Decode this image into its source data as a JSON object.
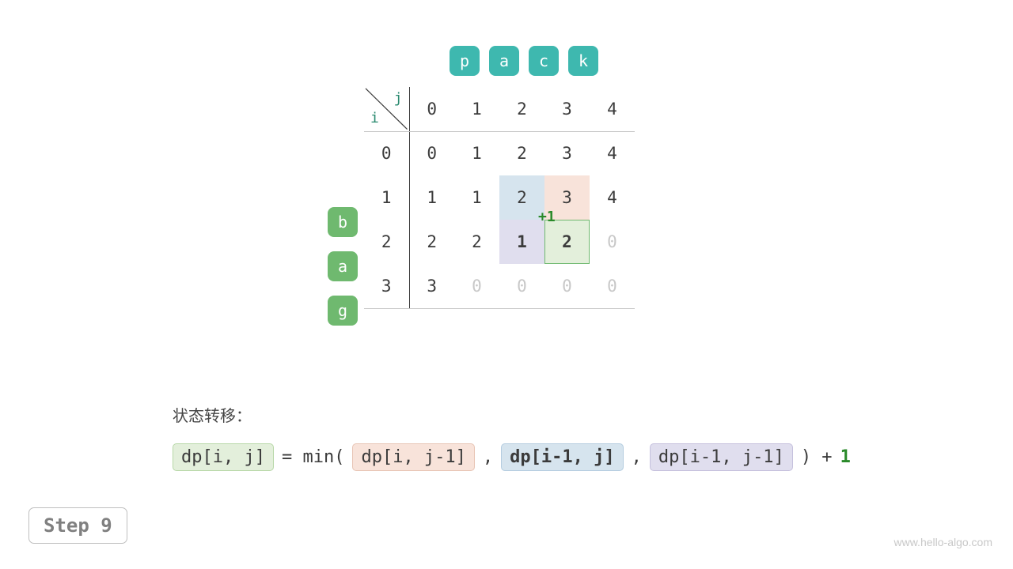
{
  "target": {
    "chars": [
      "p",
      "a",
      "c",
      "k"
    ]
  },
  "source": {
    "chars": [
      "b",
      "a",
      "g"
    ]
  },
  "axis": {
    "i": "i",
    "j": "j"
  },
  "table": {
    "col_headers": [
      "0",
      "1",
      "2",
      "3",
      "4"
    ],
    "row_headers": [
      "0",
      "1",
      "2",
      "3"
    ],
    "rows": [
      [
        {
          "v": "0"
        },
        {
          "v": "1"
        },
        {
          "v": "2"
        },
        {
          "v": "3"
        },
        {
          "v": "4"
        }
      ],
      [
        {
          "v": "1"
        },
        {
          "v": "1"
        },
        {
          "v": "2",
          "hl": "blue"
        },
        {
          "v": "3",
          "hl": "orange"
        },
        {
          "v": "4"
        }
      ],
      [
        {
          "v": "2"
        },
        {
          "v": "2"
        },
        {
          "v": "1",
          "hl": "purple",
          "bold": true
        },
        {
          "v": "2",
          "hl": "green",
          "bold": true,
          "plus": "+1"
        },
        {
          "v": "0",
          "faded": true
        }
      ],
      [
        {
          "v": "3"
        },
        {
          "v": "0",
          "faded": true
        },
        {
          "v": "0",
          "faded": true
        },
        {
          "v": "0",
          "faded": true
        },
        {
          "v": "0",
          "faded": true
        }
      ]
    ]
  },
  "formula": {
    "title": "状态转移：",
    "result": "dp[i, j]",
    "eq": " = min( ",
    "t1": "dp[i, j-1]",
    "c1": " , ",
    "t2": "dp[i-1, j]",
    "c2": " , ",
    "t3": "dp[i-1, j-1]",
    "close": " ) + ",
    "one": "1"
  },
  "step": "Step 9",
  "watermark": "www.hello-algo.com"
}
